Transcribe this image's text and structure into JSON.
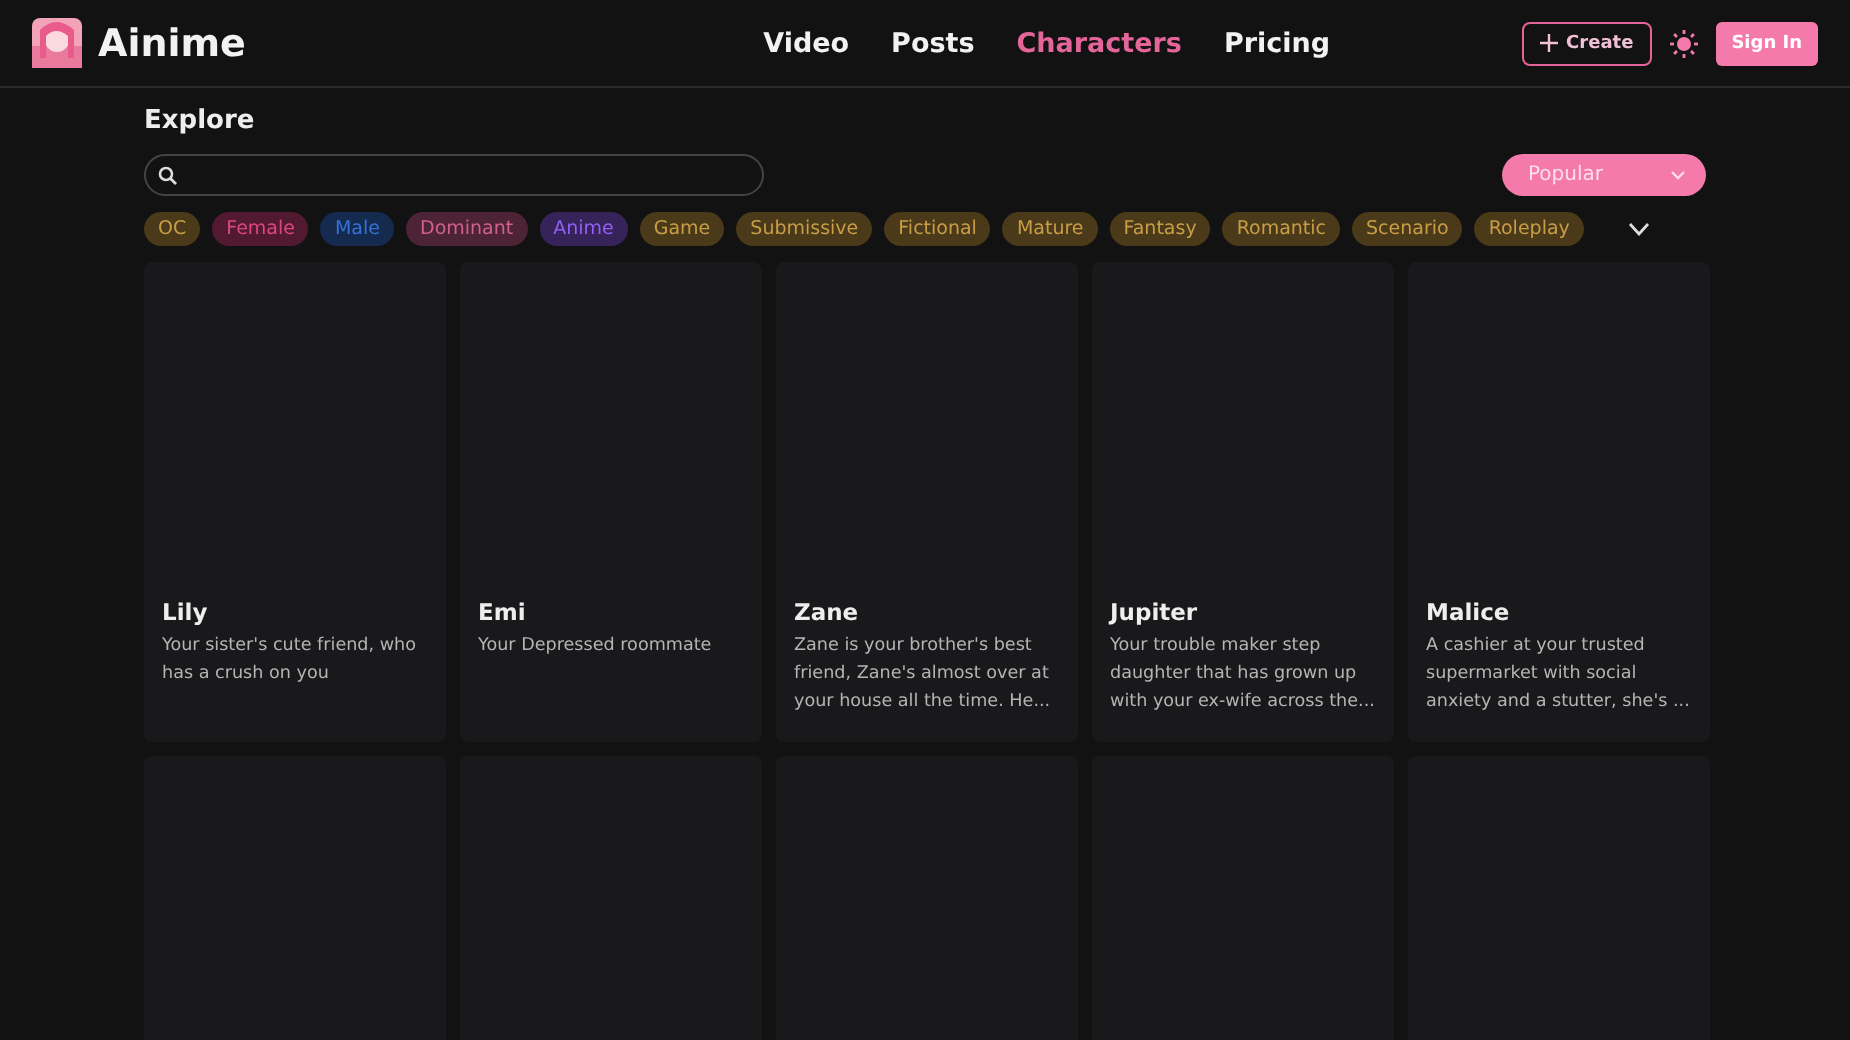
{
  "header": {
    "brand": "Ainime",
    "nav": [
      {
        "label": "Video",
        "selected": false
      },
      {
        "label": "Posts",
        "selected": false
      },
      {
        "label": "Characters",
        "selected": true
      },
      {
        "label": "Pricing",
        "selected": false
      }
    ],
    "create_button": "Create",
    "sign_in_button": "Sign In"
  },
  "explore": {
    "title": "Explore",
    "sort": {
      "value": "Popular"
    },
    "tags": [
      {
        "label": "OC",
        "color": "#4a3a1a"
      },
      {
        "label": "Female",
        "color": "#521a30"
      },
      {
        "label": "Male",
        "color": "#142a4f"
      },
      {
        "label": "Dominant",
        "color": "#4d2336"
      },
      {
        "label": "Anime",
        "color": "#36235a"
      },
      {
        "label": "Game",
        "color": "#4a3a1a"
      },
      {
        "label": "Submissive",
        "color": "#4a3a1a"
      },
      {
        "label": "Fictional",
        "color": "#4a3a1a"
      },
      {
        "label": "Mature",
        "color": "#4a3a1a"
      },
      {
        "label": "Fantasy",
        "color": "#4a3a1a"
      },
      {
        "label": "Romantic",
        "color": "#4a3a1a"
      },
      {
        "label": "Scenario",
        "color": "#4a3a1a"
      },
      {
        "label": "Roleplay",
        "color": "#4a3a1a"
      }
    ]
  },
  "cards": [
    {
      "kind": "character",
      "name": "Lily",
      "description": "Your sister's cute friend, who has a crush on you"
    },
    {
      "kind": "character",
      "name": "Emi",
      "description": "Your Depressed roommate"
    },
    {
      "kind": "character",
      "name": "Zane",
      "description": "Zane is your brother's best friend, Zane's almost over at your house all the time. He..."
    },
    {
      "kind": "character",
      "name": "Jupiter",
      "description": "Your trouble maker step daughter that has grown up with your ex-wife across the..."
    },
    {
      "kind": "character",
      "name": "Malice",
      "description": "A cashier at your trusted supermarket with social anxiety and a stutter, she's ..."
    },
    {
      "kind": "blank"
    },
    {
      "kind": "blank"
    },
    {
      "kind": "blank"
    },
    {
      "kind": "blank"
    },
    {
      "kind": "blank"
    }
  ]
}
